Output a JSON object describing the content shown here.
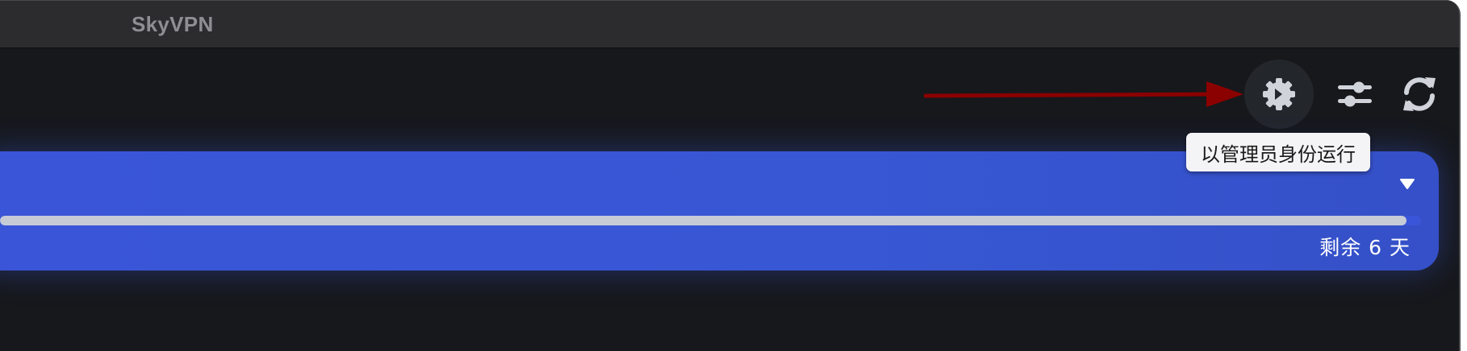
{
  "window": {
    "title": "SkyVPN"
  },
  "toolbar": {
    "buttons": [
      {
        "icon": "gear-admin-icon",
        "tooltip": "以管理员身份运行"
      },
      {
        "icon": "sliders-icon"
      },
      {
        "icon": "refresh-icon"
      }
    ]
  },
  "tooltip": {
    "text": "以管理员身份运行"
  },
  "plan": {
    "progress_fraction": 0.99,
    "remaining_text": "剩余 6 天"
  },
  "colors": {
    "background": "#16181c",
    "titlebar": "#2c2c2e",
    "card": "#3a55d8",
    "progress": "#c7cbd6",
    "annotation_arrow": "#8b0000"
  }
}
